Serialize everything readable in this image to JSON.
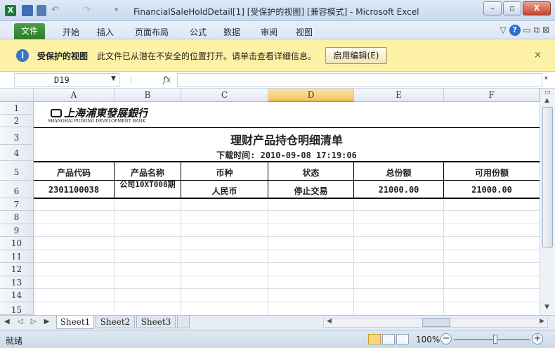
{
  "titlebar": {
    "title": "FinancialSaleHoldDetail[1]  [受保护的视图]  [兼容模式]  -  Microsoft Excel",
    "app_icon": "excel-icon",
    "qat": [
      "save-icon",
      "undo-icon",
      "redo-icon"
    ],
    "window_buttons": [
      "minimize",
      "restore",
      "close"
    ],
    "minimize_glyph": "–",
    "restore_glyph": "▫",
    "close_glyph": "X"
  },
  "ribbon": {
    "file_tab": "文件",
    "tabs": [
      "开始",
      "插入",
      "页面布局",
      "公式",
      "数据",
      "审阅",
      "视图"
    ],
    "right_icons_text": "▽",
    "help_glyph": "?",
    "window_controls_text": "▭ ⧉ ⊠"
  },
  "protected_view": {
    "icon": "info-icon",
    "icon_glyph": "i",
    "title": "受保护的视图",
    "message": "此文件已从潜在不安全的位置打开。请单击查看详细信息。",
    "enable_button": "启用编辑(E)",
    "close_glyph": "×"
  },
  "formula_bar": {
    "name_box": "D19",
    "name_box_arrow": "▼",
    "fx_label": "fx",
    "formula": ""
  },
  "columns": [
    "A",
    "B",
    "C",
    "D",
    "E",
    "F"
  ],
  "selected_column": "D",
  "rows": [
    "1",
    "2",
    "3",
    "4",
    "5",
    "6",
    "7",
    "8",
    "9",
    "10",
    "11",
    "12",
    "13",
    "14",
    "15"
  ],
  "sheet": {
    "bank_logo_cn": "上海浦東發展銀行",
    "bank_logo_en": "SHANGHAI PUDONG DEVELOPMENT BANK",
    "report_title": "理财产品持仓明细清单",
    "download_time": "下载时间: 2010-09-08 17:19:06",
    "headers": [
      "产品代码",
      "产品名称",
      "币种",
      "状态",
      "总份额",
      "可用份额"
    ],
    "row6": [
      "2301100038",
      "公司10XT008期",
      "人民币",
      "停止交易",
      "21000.00",
      "21000.00"
    ]
  },
  "sheet_tabs": [
    "Sheet1",
    "Sheet2",
    "Sheet3"
  ],
  "active_sheet": "Sheet1",
  "sheet_nav_text": "◀ ◁ ▷ ▶",
  "status": {
    "ready": "就绪",
    "zoom": "100%",
    "zoom_minus": "−",
    "zoom_plus": "+"
  }
}
